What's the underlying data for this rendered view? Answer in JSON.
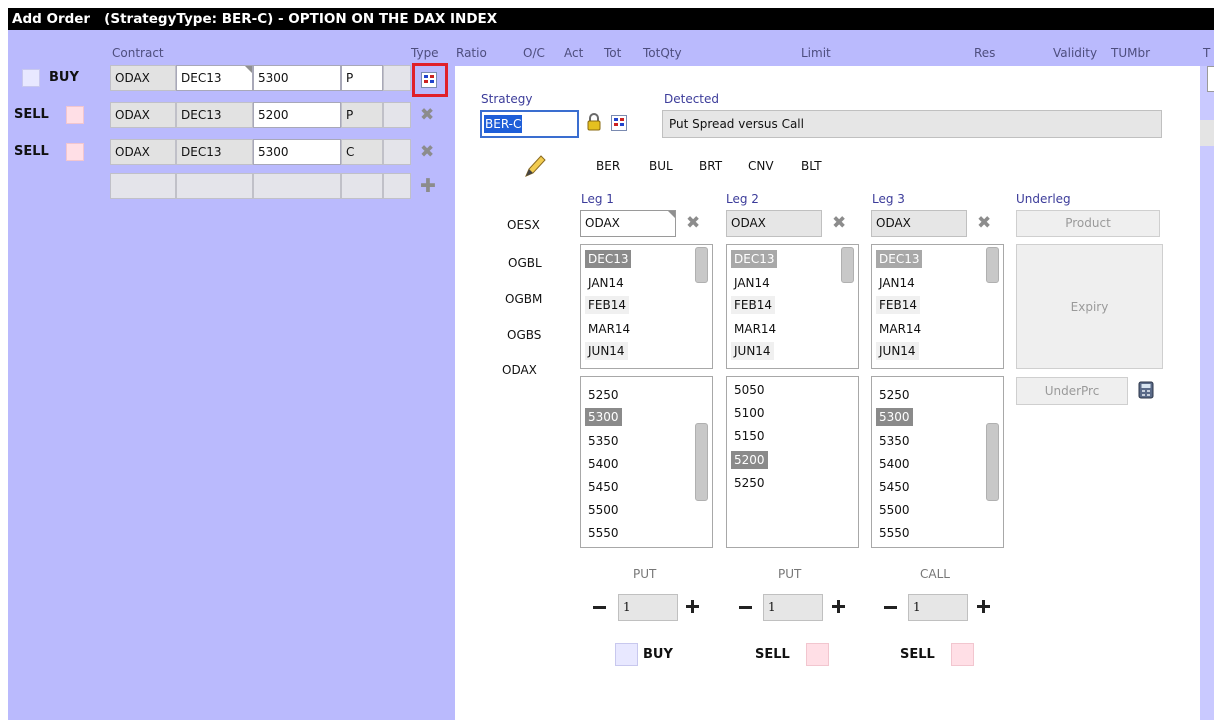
{
  "window": {
    "title": "Add Order   (StrategyType: BER-C) - OPTION ON THE DAX INDEX"
  },
  "order_grid": {
    "headers": {
      "contract": "Contract",
      "type": "Type",
      "ratio": "Ratio",
      "oc": "O/C",
      "act": "Act",
      "tot": "Tot",
      "totqty": "TotQty",
      "limit": "Limit",
      "res": "Res",
      "validity": "Validity",
      "tumbr": "TUMbr",
      "t_cut": "T"
    },
    "rows": [
      {
        "side": "BUY",
        "product": "ODAX",
        "expiry": "DEC13",
        "strike": "5300",
        "type": "P"
      },
      {
        "side": "SELL",
        "product": "ODAX",
        "expiry": "DEC13",
        "strike": "5200",
        "type": "P"
      },
      {
        "side": "SELL",
        "product": "ODAX",
        "expiry": "DEC13",
        "strike": "5300",
        "type": "C"
      }
    ]
  },
  "strategy_panel": {
    "strategy_label": "Strategy",
    "strategy_value": "BER-C",
    "detected_label": "Detected",
    "detected_value": "Put Spread versus Call",
    "strategy_types": [
      "BER",
      "BUL",
      "BRT",
      "CNV",
      "BLT"
    ],
    "products": [
      "OESX",
      "OGBL",
      "OGBM",
      "OGBS",
      "ODAX"
    ],
    "legs": [
      {
        "label": "Leg 1",
        "product": "ODAX",
        "expiries": [
          "DEC13",
          "JAN14",
          "FEB14",
          "MAR14",
          "JUN14"
        ],
        "strikes": [
          "5250",
          "5300",
          "5350",
          "5400",
          "5450",
          "5500",
          "5550"
        ],
        "callput": "PUT",
        "qty": "1",
        "side": "BUY"
      },
      {
        "label": "Leg 2",
        "product": "ODAX",
        "expiries": [
          "DEC13",
          "JAN14",
          "FEB14",
          "MAR14",
          "JUN14"
        ],
        "strikes": [
          "5050",
          "5100",
          "5150",
          "5200",
          "5250"
        ],
        "callput": "PUT",
        "qty": "1",
        "side": "SELL"
      },
      {
        "label": "Leg 3",
        "product": "ODAX",
        "expiries": [
          "DEC13",
          "JAN14",
          "FEB14",
          "MAR14",
          "JUN14"
        ],
        "strikes": [
          "5250",
          "5300",
          "5350",
          "5400",
          "5450",
          "5500",
          "5550"
        ],
        "callput": "CALL",
        "qty": "1",
        "side": "SELL"
      }
    ],
    "underleg": {
      "label": "Underleg",
      "product_btn": "Product",
      "expiry_btn": "Expiry",
      "underprc_btn": "UnderPrc"
    }
  },
  "colors": {
    "background": "#babafd",
    "title_bar": "#000000",
    "highlight": "#e0202a",
    "selected": "#8a8a8a",
    "strategy_input_selection": "#1e5ed8"
  }
}
